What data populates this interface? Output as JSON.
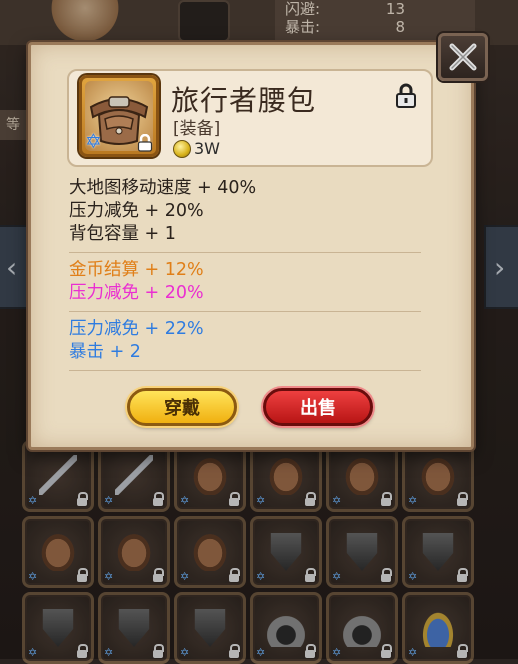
{
  "background": {
    "stats": [
      {
        "label": "闪避:",
        "value": "13"
      },
      {
        "label": "暴击:",
        "value": "8"
      }
    ],
    "left_label": "等",
    "nav_left": "‹",
    "nav_right": "›",
    "inventory": [
      [
        "sword",
        "sword",
        "bag",
        "bag",
        "bag",
        "bag"
      ],
      [
        "bag",
        "bag",
        "bag",
        "shield",
        "shield",
        "shield"
      ],
      [
        "shield",
        "shield",
        "shield",
        "helm",
        "helm",
        "bluehat"
      ]
    ]
  },
  "item": {
    "name": "旅行者腰包",
    "type": "[装备]",
    "price": "3W",
    "icon": "waist-bag-icon",
    "quality_icon": "star-of-david-icon",
    "locked": true
  },
  "stats": {
    "base": [
      "大地图移动速度 + 40%",
      "压力减免 + 20%",
      "背包容量 + 1"
    ],
    "special": [
      {
        "text": "金币结算 + 12%",
        "color": "#e07f18"
      },
      {
        "text": "压力减免 + 20%",
        "color": "#ea2fd1"
      }
    ],
    "extra": [
      "压力减免 + 22%",
      "暴击 + 2"
    ]
  },
  "buttons": {
    "wear": "穿戴",
    "sell": "出售"
  },
  "colors": {
    "accent_wear": "#f0b010",
    "accent_sell": "#d52222",
    "stat_blue": "#2f7ce0",
    "parchment": "#e9dbc0"
  }
}
